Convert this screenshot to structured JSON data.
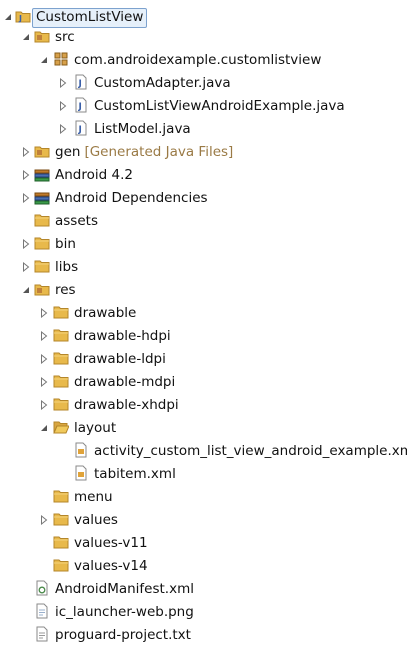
{
  "tree": [
    {
      "label": "CustomListView",
      "icon": "java-project-icon",
      "expanded": true,
      "selected": true
    },
    {
      "label": "src",
      "icon": "source-folder-icon",
      "expanded": true
    },
    {
      "label": "com.androidexample.customlistview",
      "icon": "package-icon",
      "expanded": true
    },
    {
      "label": "CustomAdapter.java",
      "icon": "java-file-icon",
      "expanded": false
    },
    {
      "label": "CustomListViewAndroidExample.java",
      "icon": "java-file-icon",
      "expanded": false
    },
    {
      "label": "ListModel.java",
      "icon": "java-file-icon",
      "expanded": false
    },
    {
      "label": "gen",
      "decoration": "[Generated Java Files]",
      "icon": "source-folder-icon",
      "expanded": false
    },
    {
      "label": "Android 4.2",
      "icon": "library-icon",
      "expanded": false
    },
    {
      "label": "Android Dependencies",
      "icon": "library-icon",
      "expanded": false
    },
    {
      "label": "assets",
      "icon": "folder-icon"
    },
    {
      "label": "bin",
      "icon": "folder-icon",
      "expanded": false
    },
    {
      "label": "libs",
      "icon": "folder-icon",
      "expanded": false
    },
    {
      "label": "res",
      "icon": "folder-icon",
      "expanded": true
    },
    {
      "label": "drawable",
      "icon": "folder-icon",
      "expanded": false
    },
    {
      "label": "drawable-hdpi",
      "icon": "folder-icon",
      "expanded": false
    },
    {
      "label": "drawable-ldpi",
      "icon": "folder-icon",
      "expanded": false
    },
    {
      "label": "drawable-mdpi",
      "icon": "folder-icon",
      "expanded": false
    },
    {
      "label": "drawable-xhdpi",
      "icon": "folder-icon",
      "expanded": false
    },
    {
      "label": "layout",
      "icon": "folder-icon",
      "expanded": true
    },
    {
      "label": "activity_custom_list_view_android_example.xml",
      "icon": "xml-file-icon"
    },
    {
      "label": "tabitem.xml",
      "icon": "xml-file-icon"
    },
    {
      "label": "menu",
      "icon": "folder-icon"
    },
    {
      "label": "values",
      "icon": "folder-icon",
      "expanded": false
    },
    {
      "label": "values-v11",
      "icon": "folder-icon"
    },
    {
      "label": "values-v14",
      "icon": "folder-icon"
    },
    {
      "label": "AndroidManifest.xml",
      "icon": "manifest-file-icon"
    },
    {
      "label": "ic_launcher-web.png",
      "icon": "image-file-icon"
    },
    {
      "label": "proguard-project.txt",
      "icon": "text-file-icon"
    }
  ],
  "colors": {
    "folder": "#e8b94b",
    "folder_edge": "#b4862a",
    "decoration": "#9a7a45",
    "selection_bg": "#e6f0fa",
    "selection_border": "#7da2ce"
  }
}
